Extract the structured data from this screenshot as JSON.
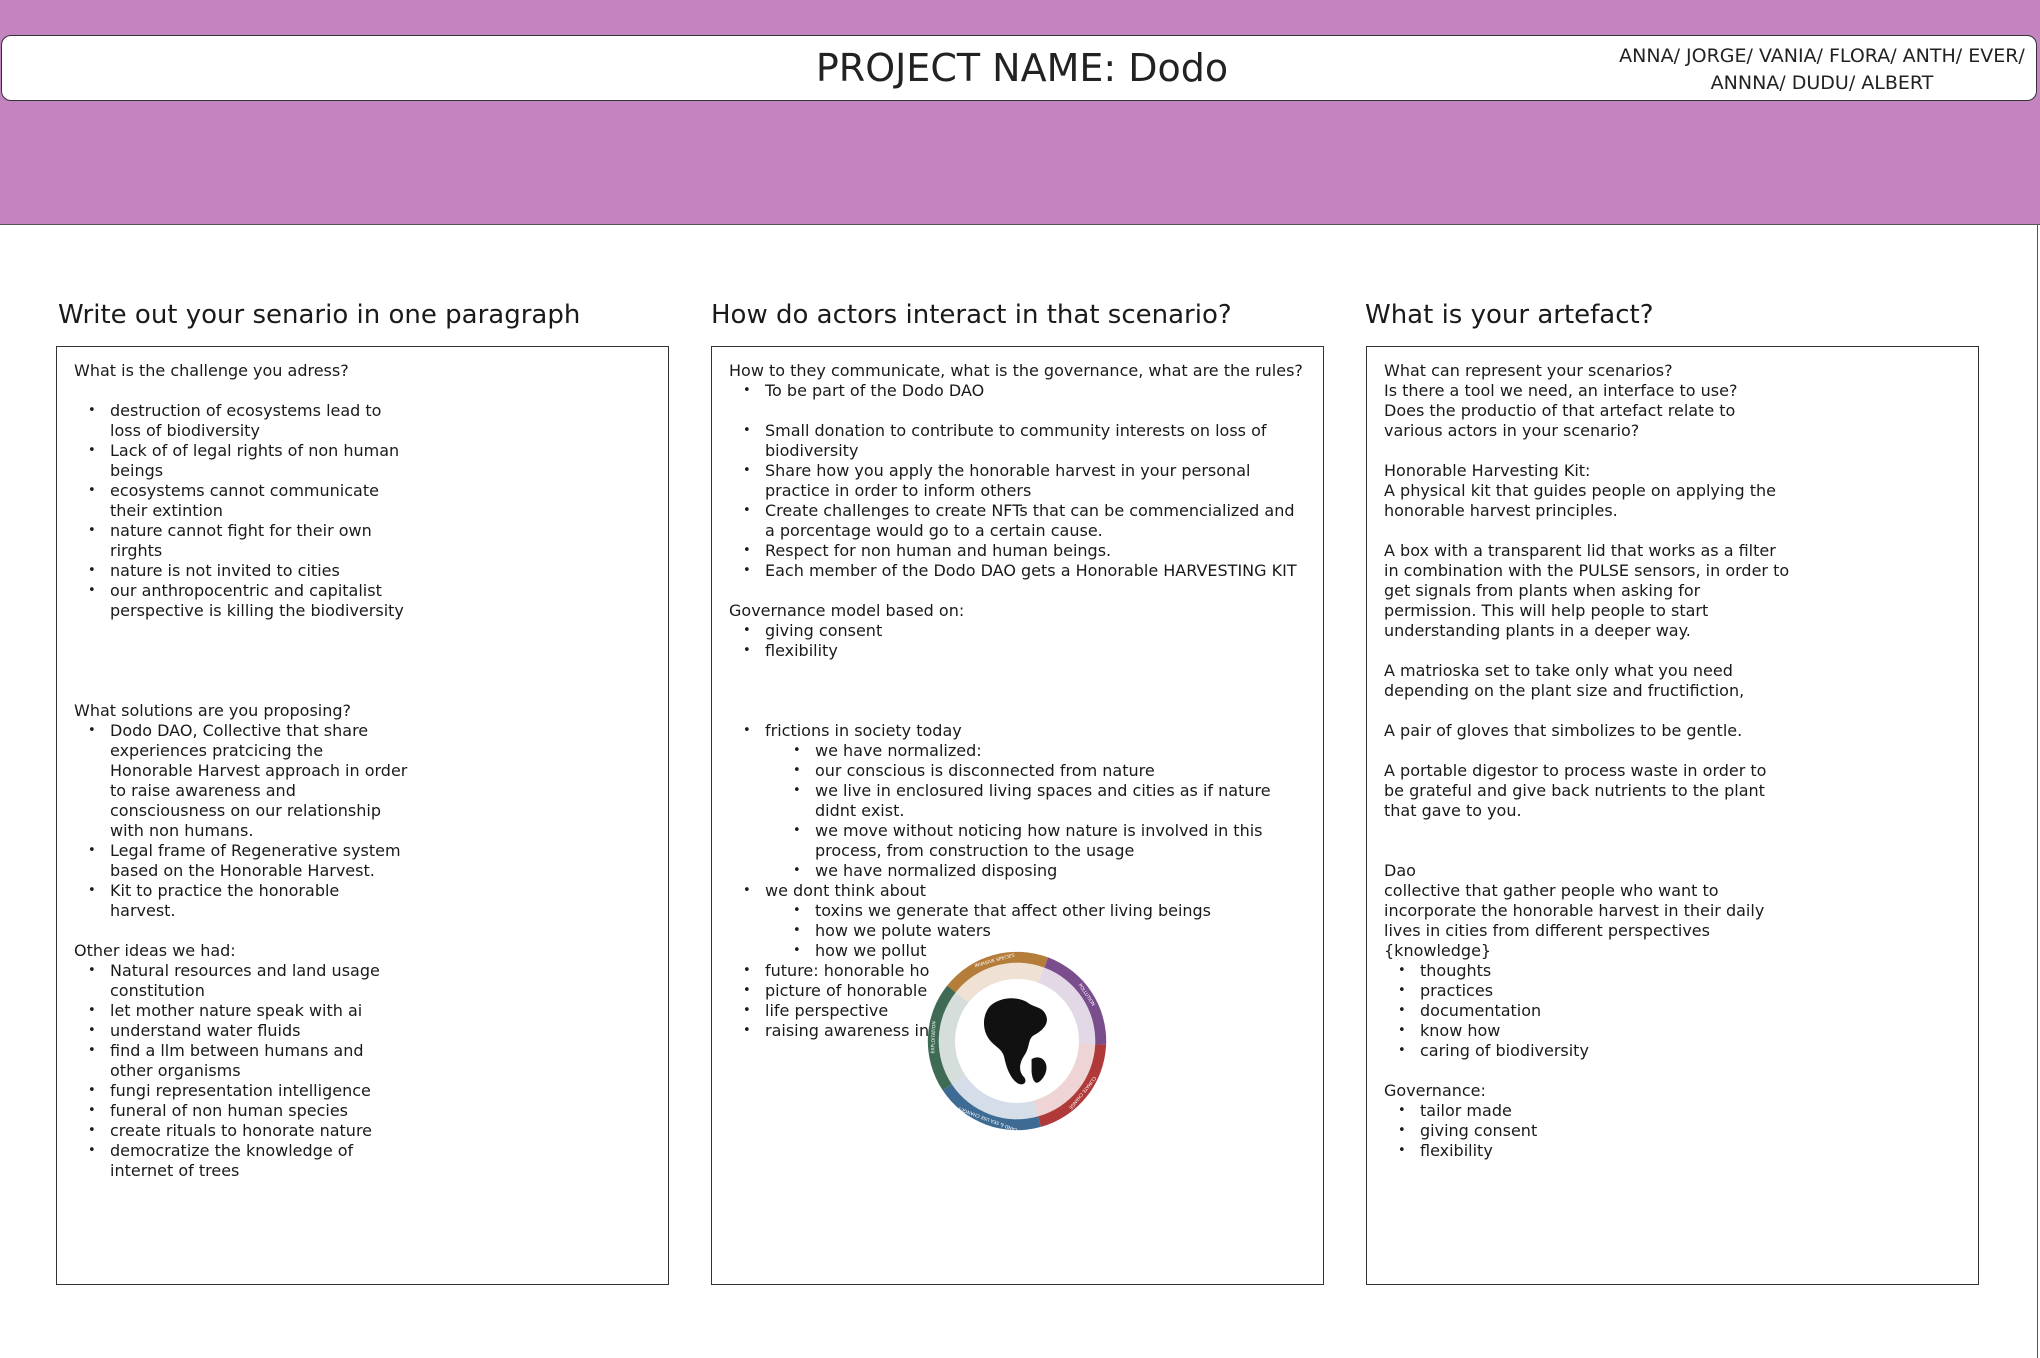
{
  "header": {
    "project_title": "PROJECT NAME: Dodo",
    "team_line1": "ANNA/ JORGE/ VANIA/ FLORA/ ANTH/ EVER/",
    "team_line2": "ANNNA/ DUDU/ ALBERT",
    "band_color": "#c484c0"
  },
  "col1": {
    "title": "Write out your senario in one paragraph",
    "q_challenge": "What is the challenge you adress?",
    "challenges": [
      "destruction of ecosystems lead to\nloss of biodiversity",
      "Lack of of legal rights of non human\nbeings",
      "ecosystems cannot communicate\ntheir extintion",
      "nature cannot fight for their own\nrirghts",
      "nature is not invited to cities",
      "our anthropocentric and capitalist\nperspective is killing the biodiversity"
    ],
    "q_solutions": "What solutions are you proposing?",
    "solutions": [
      "Dodo DAO, Collective that share\nexperiences pratcicing the\nHonorable Harvest approach in order\nto raise awareness and\nconsciousness on our relationship\nwith non humans.",
      "Legal frame of Regenerative system\nbased on the Honorable Harvest.",
      "Kit to practice the honorable\nharvest."
    ],
    "q_other": "Other ideas we had:",
    "other_ideas": [
      "Natural resources and land usage\nconstitution",
      "let mother nature speak with ai",
      "understand water fluids",
      "find a llm between humans and\nother organisms",
      "fungi representation intelligence",
      "funeral of non human species",
      "create rituals to honorate nature",
      "democratize the knowledge of\ninternet of trees"
    ]
  },
  "col2": {
    "title": "How do actors interact in that scenario?",
    "q_communicate": "How to they communicate, what is the governance, what are the rules?",
    "item_part": "To be part of the Dodo DAO",
    "rules": [
      "Small donation to contribute to community interests on loss of\nbiodiversity",
      "Share how you apply the honorable harvest in your personal\npractice in order to inform others",
      "Create challenges to create NFTs that can be commencialized and\na porcentage would go to a certain cause.",
      "Respect for non human and human beings.",
      "Each member of the Dodo DAO gets a Honorable HARVESTING KIT"
    ],
    "governance_label": "Governance model based on:",
    "governance": [
      "giving consent",
      "flexibility"
    ],
    "frictions_label": "frictions in society today",
    "normalized": [
      "we have normalized:",
      "our conscious is disconnected from nature",
      "we live in enclosured living spaces and cities as if nature\ndidnt exist.",
      "we move without noticing how nature is involved in this\nprocess, from construction to the usage",
      "we have normalized disposing"
    ],
    "dont_think_label": "we dont think about",
    "dont_think": [
      "toxins we generate that affect other living beings",
      "how we polute waters",
      "how we pollut"
    ],
    "tail": [
      "future: honorable ho",
      "picture of honorable",
      "life perspective",
      "raising awareness in"
    ],
    "wheel": {
      "segments": [
        "INVASIVE SPECIES",
        "POLLUTION",
        "CLIMATE CHANGE",
        "LAND & SEA USE CHANGES",
        "EXPLOITATION"
      ],
      "colors": [
        "#b47d3a",
        "#7a4d8c",
        "#b03a3a",
        "#3e6b94",
        "#3f6b55"
      ]
    }
  },
  "col3": {
    "title": "What is your artefact?",
    "questions": "What can represent your scenarios?\nIs there a tool we need, an interface to use?\nDoes the productio of that artefact relate to\nvarious actors in your scenario?",
    "kit": "Honorable Harvesting Kit:\nA physical kit that guides people on applying the\nhonorable harvest principles.",
    "box": "A box with a transparent lid that works as a filter\nin combination with the PULSE sensors, in order to\nget signals from plants when asking for\npermission. This will help people to start\nunderstanding plants in a deeper way.",
    "matrioska": "A matrioska set to take only what you need\ndepending on the plant size and fructifiction,",
    "gloves": "A pair of gloves that simbolizes to be gentle.",
    "digestor": "A portable digestor to process waste in order to\nbe grateful and give back nutrients to the plant\nthat gave to you.",
    "dao": "Dao\ncollective that gather people who want to\nincorporate the honorable harvest in their daily\nlives in cities from different perspectives\n{knowledge}",
    "dao_items": [
      "thoughts",
      "practices",
      "documentation",
      "know how",
      "caring of biodiversity"
    ],
    "governance_label": "Governance:",
    "governance": [
      "tailor made",
      "giving consent",
      "flexibility"
    ]
  }
}
